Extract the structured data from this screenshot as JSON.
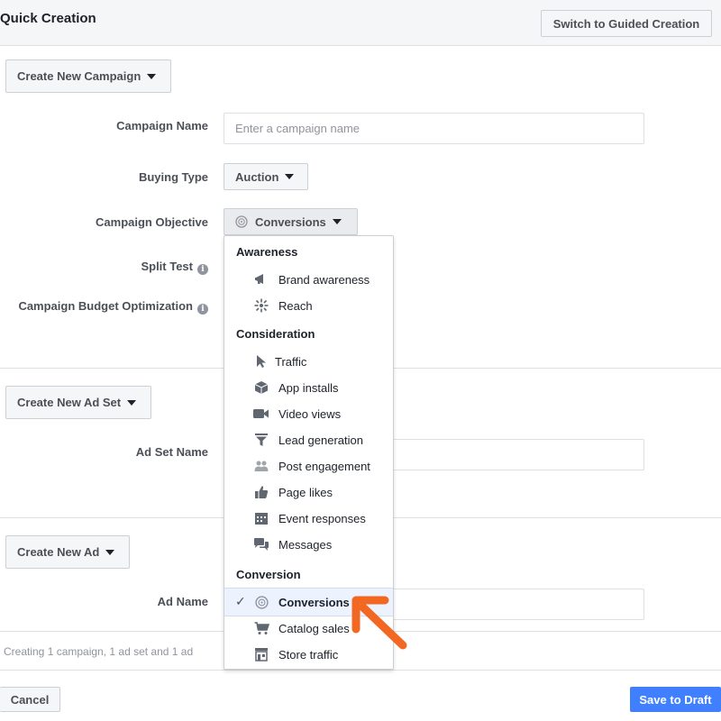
{
  "header": {
    "title": "Quick Creation",
    "switch_button": "Switch to Guided Creation"
  },
  "campaign": {
    "create_button": "Create New Campaign",
    "name_label": "Campaign Name",
    "name_placeholder": "Enter a campaign name",
    "buying_type_label": "Buying Type",
    "buying_type_value": "Auction",
    "objective_label": "Campaign Objective",
    "objective_value": "Conversions",
    "split_test_label": "Split Test",
    "budget_opt_label": "Campaign Budget Optimization"
  },
  "adset": {
    "create_button": "Create New Ad Set",
    "name_label": "Ad Set Name"
  },
  "ad": {
    "create_button": "Create New Ad",
    "name_label": "Ad Name"
  },
  "footer": {
    "summary": "Creating 1 campaign, 1 ad set and 1 ad",
    "cancel": "Cancel",
    "save": "Save to Draft"
  },
  "objective_menu": {
    "groups": [
      {
        "label": "Awareness",
        "items": [
          {
            "label": "Brand awareness",
            "icon": "megaphone-icon"
          },
          {
            "label": "Reach",
            "icon": "reach-icon"
          }
        ]
      },
      {
        "label": "Consideration",
        "items": [
          {
            "label": "Traffic",
            "icon": "cursor-icon"
          },
          {
            "label": "App installs",
            "icon": "box-icon"
          },
          {
            "label": "Video views",
            "icon": "video-camera-icon"
          },
          {
            "label": "Lead generation",
            "icon": "funnel-icon"
          },
          {
            "label": "Post engagement",
            "icon": "people-icon"
          },
          {
            "label": "Page likes",
            "icon": "thumbs-up-icon"
          },
          {
            "label": "Event responses",
            "icon": "calendar-icon"
          },
          {
            "label": "Messages",
            "icon": "chat-bubbles-icon"
          }
        ]
      },
      {
        "label": "Conversion",
        "items": [
          {
            "label": "Conversions",
            "icon": "globe-icon",
            "selected": true
          },
          {
            "label": "Catalog sales",
            "icon": "cart-icon"
          },
          {
            "label": "Store traffic",
            "icon": "store-icon"
          }
        ]
      }
    ]
  },
  "colors": {
    "accent_blue": "#4080ff",
    "annotation_arrow": "#f26722",
    "selected_bg": "#ecf3ff"
  }
}
